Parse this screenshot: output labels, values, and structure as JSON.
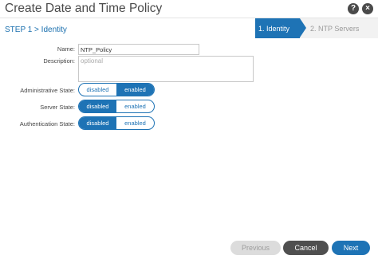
{
  "dialog": {
    "title": "Create Date and Time Policy",
    "help_icon": "help-icon",
    "close_icon": "close-icon",
    "help_glyph": "?",
    "close_glyph": "×"
  },
  "step": {
    "heading": "STEP 1 > Identity"
  },
  "wizard": {
    "steps": [
      {
        "label": "1. Identity",
        "active": true
      },
      {
        "label": "2. NTP Servers",
        "active": false
      }
    ]
  },
  "form": {
    "name": {
      "label": "Name:",
      "value": "NTP_Policy"
    },
    "description": {
      "label": "Description:",
      "placeholder": "optional",
      "value": ""
    },
    "admin_state": {
      "label": "Administrative State:",
      "options": [
        "disabled",
        "enabled"
      ],
      "selected": "enabled"
    },
    "server_state": {
      "label": "Server State:",
      "options": [
        "disabled",
        "enabled"
      ],
      "selected": "disabled"
    },
    "auth_state": {
      "label": "Authentication State:",
      "options": [
        "disabled",
        "enabled"
      ],
      "selected": "disabled"
    }
  },
  "footer": {
    "previous_label": "Previous",
    "cancel_label": "Cancel",
    "next_label": "Next"
  },
  "colors": {
    "accent": "#1e73b5",
    "dark_button": "#4f4f4f",
    "disabled_button": "#dcdcdc"
  }
}
